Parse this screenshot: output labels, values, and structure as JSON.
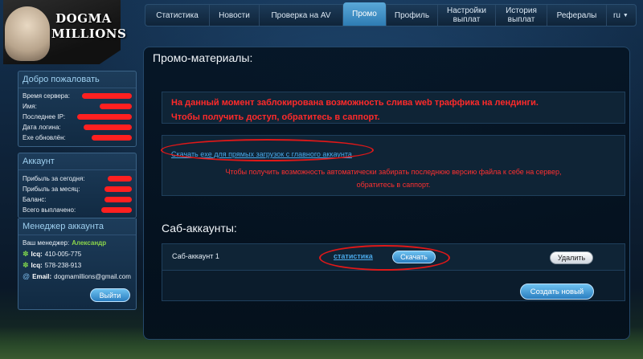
{
  "logo": {
    "line1": "DOGMA",
    "line2": "MILLIONS"
  },
  "nav": {
    "items": [
      {
        "label": "Статистика"
      },
      {
        "label": "Новости"
      },
      {
        "label": "Проверка на AV"
      },
      {
        "label": "Промо"
      },
      {
        "label": "Профиль"
      },
      {
        "label": "Настройки\nвыплат"
      },
      {
        "label": "История\nвыплат"
      },
      {
        "label": "Рефералы"
      }
    ],
    "active_label": "Промо",
    "lang": "ru"
  },
  "welcome": {
    "title": "Добро пожаловать",
    "rows": [
      {
        "label": "Время сервера:"
      },
      {
        "label": "Имя:"
      },
      {
        "label": "Последнее IP:"
      },
      {
        "label": "Дата логина:"
      },
      {
        "label": "Exe обновлён:"
      }
    ]
  },
  "account": {
    "title": "Аккаунт",
    "rows": [
      {
        "label": "Прибыль за сегодня:"
      },
      {
        "label": "Прибыль за месяц:"
      },
      {
        "label": "Баланс:"
      },
      {
        "label": "Всего выплачено:"
      }
    ]
  },
  "manager": {
    "title": "Менеджер аккаунта",
    "label": "Ваш менеджер:",
    "name": "Александр",
    "icq_label": "Icq:",
    "icq1": "410-005-775",
    "icq2": "578-238-913",
    "email_label": "Email:",
    "email": "dogmamillions@gmail.com",
    "logout": "Выйти"
  },
  "promo": {
    "title": "Промо-материалы:",
    "warning_line1": "На данный момент заблокирована возможность слива web траффика на лендинги.",
    "warning_line2": "Чтобы получить доступ, обратитесь в саппорт.",
    "download_link": "Скачать exe для прямых загрузок с главного аккаунта",
    "auto_line1": "Чтобы получить возможность автоматически забирать последнюю версию файла к себе на сервер,",
    "auto_line2": "обратитесь в саппорт."
  },
  "subaccounts": {
    "title": "Саб-аккаунты:",
    "rows": [
      {
        "name": "Саб-аккаунт 1",
        "stats": "статистика",
        "download": "Скачать",
        "delete": "Удалить"
      }
    ],
    "create": "Создать новый"
  },
  "colors": {
    "warning": "#ff2a2a",
    "accent_blue": "#2e7cb4",
    "link": "#4aa8e8",
    "manager_name": "#8bd44a",
    "annotation_oval": "#e01818"
  }
}
